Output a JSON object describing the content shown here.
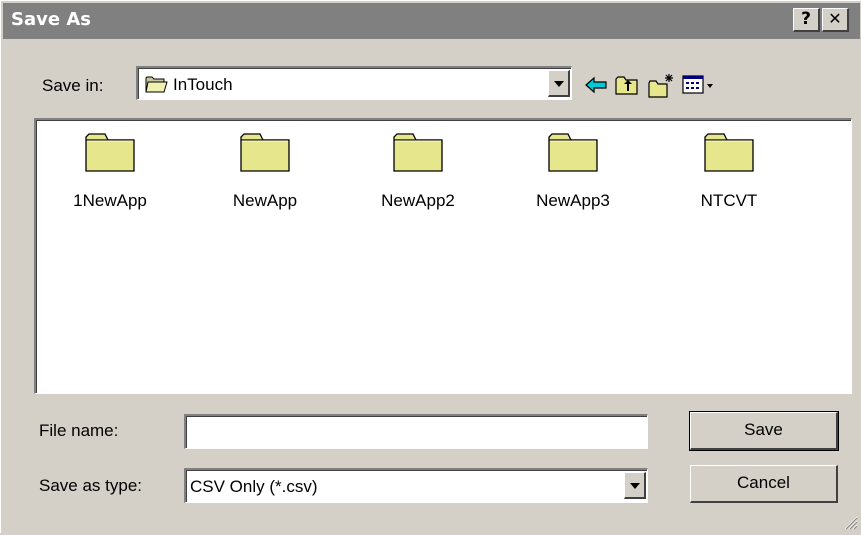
{
  "window": {
    "title": "Save As",
    "help_label": "?",
    "close_label": "✕"
  },
  "save_in": {
    "label": "Save in:",
    "value": "InTouch",
    "folder_icon": "open-folder-icon"
  },
  "toolbar": {
    "icons": [
      "back-arrow-icon",
      "up-one-level-icon",
      "new-folder-icon",
      "view-menu-icon"
    ]
  },
  "files": [
    {
      "name": "1NewApp",
      "icon": "folder-icon"
    },
    {
      "name": "NewApp",
      "icon": "folder-icon"
    },
    {
      "name": "NewApp2",
      "icon": "folder-icon"
    },
    {
      "name": "NewApp3",
      "icon": "folder-icon"
    },
    {
      "name": "NTCVT",
      "icon": "folder-icon"
    }
  ],
  "file_name": {
    "label": "File name:",
    "value": ""
  },
  "save_as_type": {
    "label": "Save as type:",
    "value": "CSV Only (*.csv)"
  },
  "buttons": {
    "save": "Save",
    "cancel": "Cancel"
  },
  "colors": {
    "face": "#d4d0c8",
    "titlebar": "#808080",
    "folder": "#e6e68c",
    "back_arrow": "#00c8d8"
  }
}
